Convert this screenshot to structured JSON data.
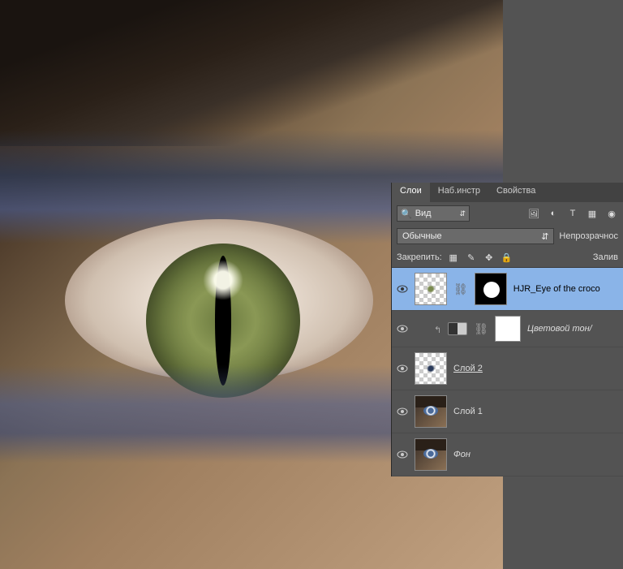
{
  "tabs": {
    "layers": "Слои",
    "channels": "Наб.инстр",
    "paths": "Свойства"
  },
  "filter": {
    "kind": "Вид",
    "search_icon": "🔍"
  },
  "filter_icons": [
    "🖼",
    "◐",
    "T",
    "▦",
    "◉"
  ],
  "blend": {
    "mode": "Обычные",
    "opacity_label": "Непрозрачнос"
  },
  "lock": {
    "label": "Закрепить:",
    "fill_label": "Залив"
  },
  "layers": [
    {
      "name": "HJR_Eye of the croco",
      "visible": true,
      "selected": true,
      "has_mask": true,
      "linked": true
    },
    {
      "name": "Цветовой тон/",
      "visible": true,
      "clipped": true,
      "adjustment": true,
      "has_mask": true
    },
    {
      "name": "Слой 2",
      "visible": true,
      "underline": true
    },
    {
      "name": "Слой 1",
      "visible": true,
      "image": true
    },
    {
      "name": "Фон",
      "visible": true,
      "image": true,
      "italic": true
    }
  ]
}
